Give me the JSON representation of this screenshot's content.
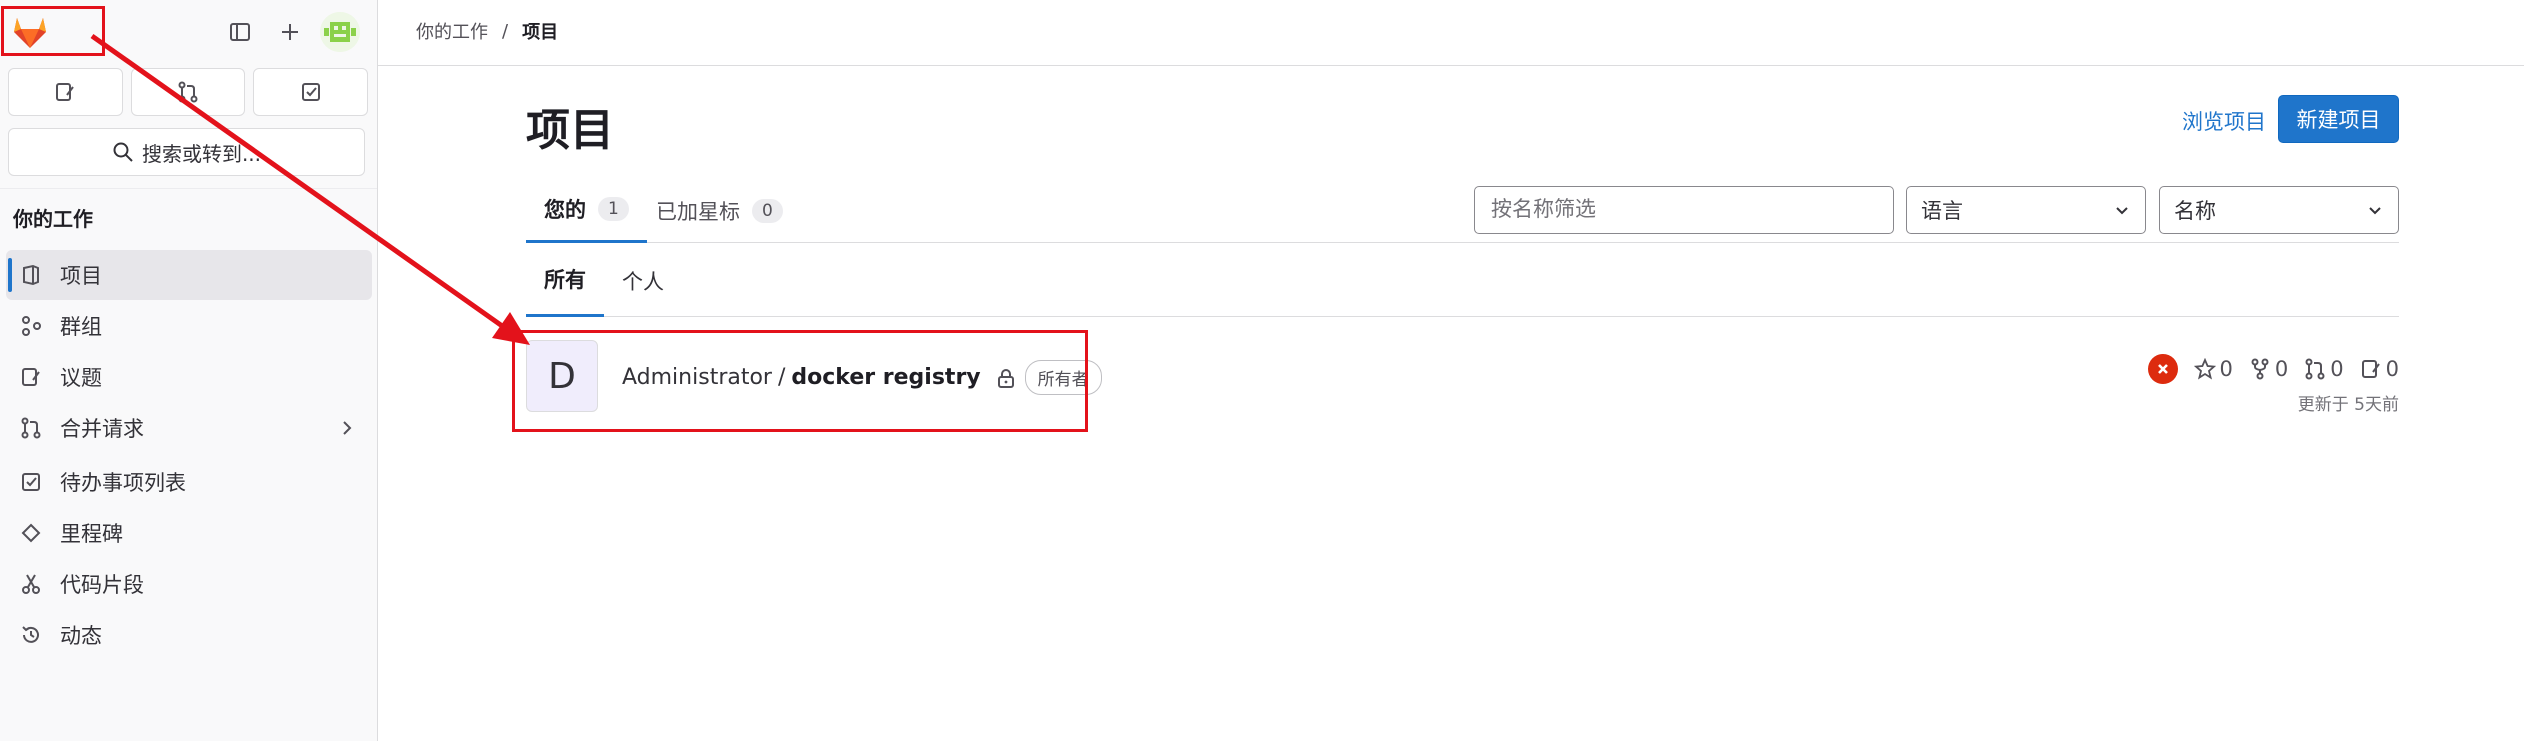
{
  "sidebar": {
    "heading": "你的工作",
    "search_label": "搜索或转到...",
    "items": [
      {
        "label": "项目",
        "icon": "project-icon"
      },
      {
        "label": "群组",
        "icon": "group-icon"
      },
      {
        "label": "议题",
        "icon": "issues-icon"
      },
      {
        "label": "合并请求",
        "icon": "merge-request-icon"
      },
      {
        "label": "待办事项列表",
        "icon": "todo-icon"
      },
      {
        "label": "里程碑",
        "icon": "milestone-icon"
      },
      {
        "label": "代码片段",
        "icon": "snippet-icon"
      },
      {
        "label": "动态",
        "icon": "history-icon"
      }
    ]
  },
  "breadcrumb": {
    "parent": "你的工作",
    "separator": "/",
    "current": "项目"
  },
  "main": {
    "title": "项目",
    "browse_link": "浏览项目",
    "new_button": "新建项目",
    "tabs": [
      {
        "label": "您的",
        "count": "1"
      },
      {
        "label": "已加星标",
        "count": "0"
      }
    ],
    "filter_placeholder": "按名称筛选",
    "language_dropdown": "语言",
    "sort_dropdown": "名称",
    "subtabs": [
      {
        "label": "所有"
      },
      {
        "label": "个人"
      }
    ],
    "project": {
      "avatar_letter": "D",
      "namespace": "Administrator",
      "separator": "/",
      "name": "docker registry",
      "role_badge": "所有者",
      "stars": "0",
      "forks": "0",
      "merge_requests": "0",
      "issues": "0",
      "updated": "更新于 5天前"
    }
  },
  "colors": {
    "accent": "#1f75cb",
    "annotation": "#e3121b",
    "pipeline_failed": "#dd2b0e"
  }
}
